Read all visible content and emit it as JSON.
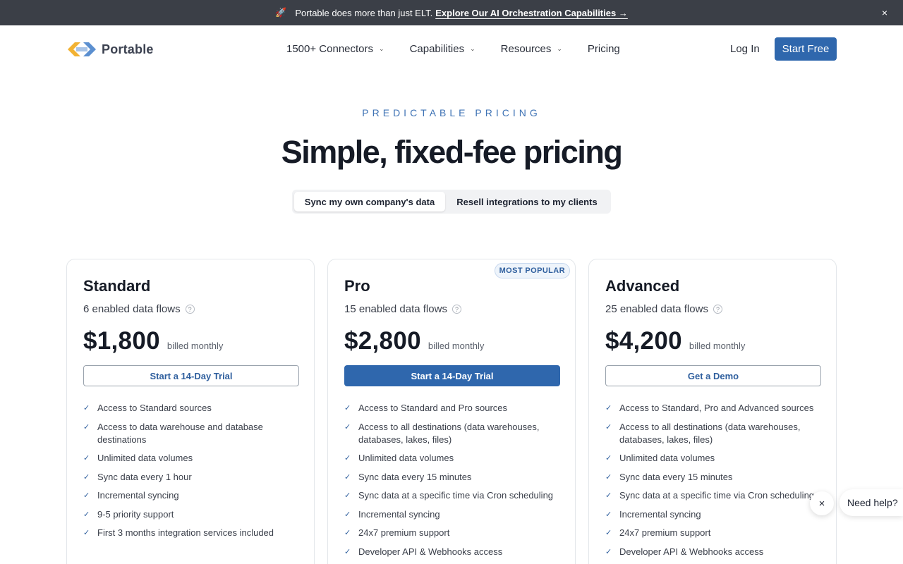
{
  "announcement": {
    "icon": "rocket-icon",
    "text": "Portable does more than just ELT.",
    "link": "Explore Our AI Orchestration Capabilities →",
    "close": "×"
  },
  "nav": {
    "brand": "Portable",
    "menu": [
      "1500+ Connectors",
      "Capabilities",
      "Resources",
      "Pricing"
    ],
    "login": "Log In",
    "start_free": "Start Free"
  },
  "hero": {
    "eyebrow": "PREDICTABLE PRICING",
    "title": "Simple, fixed-fee pricing",
    "toggle": [
      "Sync my own company's data",
      "Resell integrations to my clients"
    ],
    "toggle_active": 0
  },
  "plans": [
    {
      "name": "Standard",
      "flows": "6 enabled data flows",
      "price": "$1,800",
      "billing": "billed monthly",
      "cta": "Start a 14-Day Trial",
      "badge": "",
      "features": [
        "Access to Standard sources",
        "Access to data warehouse and database destinations",
        "Unlimited data volumes",
        "Sync data every 1 hour",
        "Incremental syncing",
        "9-5 priority support",
        "First 3 months integration services included"
      ]
    },
    {
      "name": "Pro",
      "flows": "15 enabled data flows",
      "price": "$2,800",
      "billing": "billed monthly",
      "cta": "Start a 14-Day Trial",
      "badge": "MOST POPULAR",
      "features": [
        "Access to Standard and Pro sources",
        "Access to all destinations (data warehouses, databases, lakes, files)",
        "Unlimited data volumes",
        "Sync data every 15 minutes",
        "Sync data at a specific time via Cron scheduling",
        "Incremental syncing",
        "24x7 premium support",
        "Developer API & Webhooks access"
      ]
    },
    {
      "name": "Advanced",
      "flows": "25 enabled data flows",
      "price": "$4,200",
      "billing": "billed monthly",
      "cta": "Get a Demo",
      "badge": "",
      "features": [
        "Access to Standard, Pro and Advanced sources",
        "Access to all destinations (data warehouses, databases, lakes, files)",
        "Unlimited data volumes",
        "Sync data every 15 minutes",
        "Sync data at a specific time via Cron scheduling",
        "Incremental syncing",
        "24x7 premium support",
        "Developer API & Webhooks access"
      ]
    }
  ],
  "help_widget": {
    "label": "Need help?",
    "close": "×"
  },
  "colors": {
    "accent": "#2f67ad",
    "announcement_bg": "#3b3f47",
    "eyebrow": "#3f73b5"
  }
}
